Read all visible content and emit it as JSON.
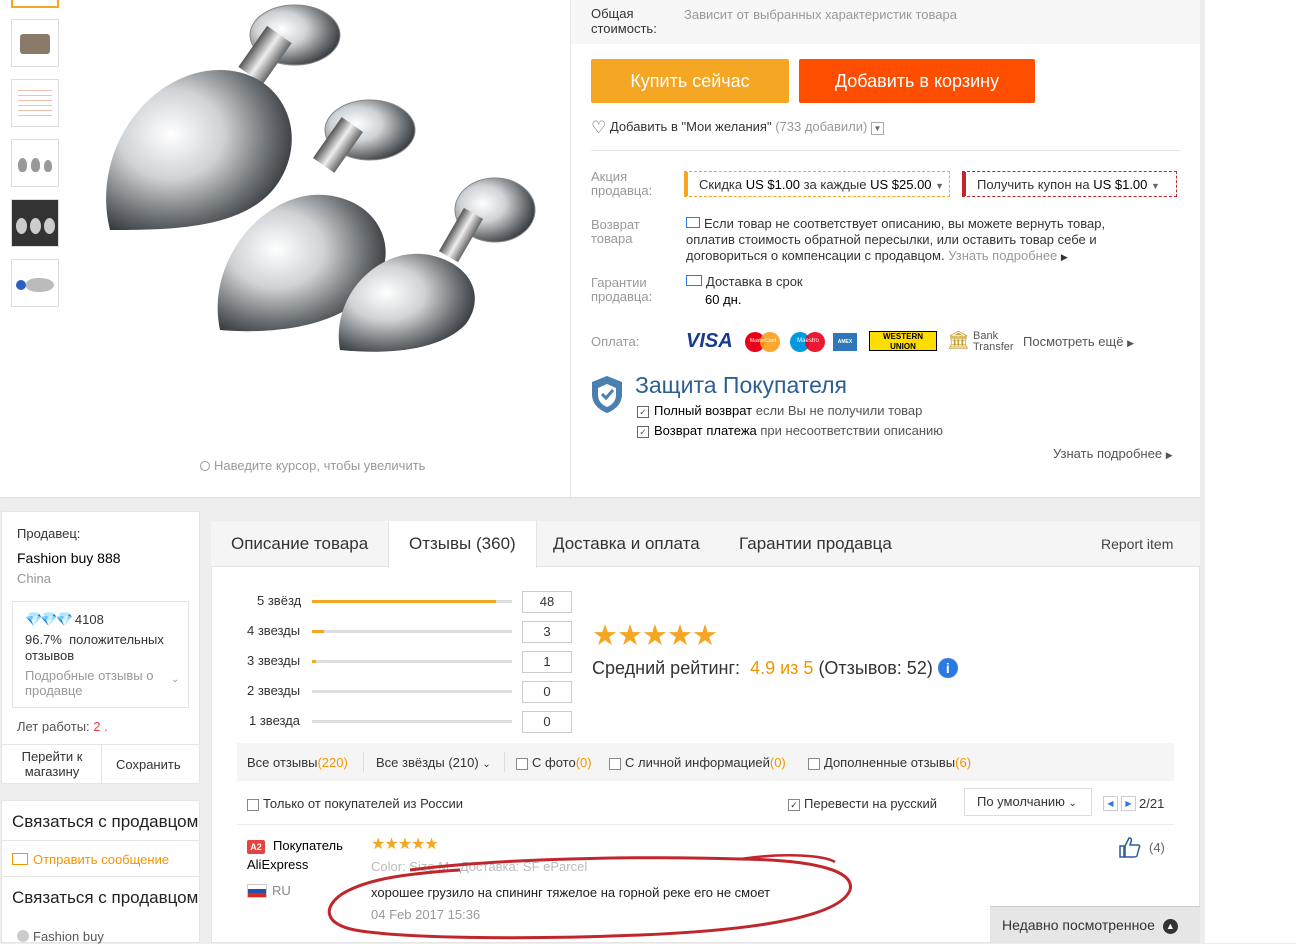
{
  "gallery": {
    "hover_hint": "Наведите курсор, чтобы увеличить"
  },
  "price": {
    "total_label": "Общая стоимость:",
    "total_value": "Зависит от выбранных характеристик товара"
  },
  "actions": {
    "buy_now": "Купить сейчас",
    "add_to_cart": "Добавить в корзину",
    "wishlist_label": "Добавить в \"Мои желания\"",
    "wishlist_count": "(733 добавили)"
  },
  "promo": {
    "label": "Акция продавца:",
    "discount_prefix": "Скидка",
    "discount_amount": "US $1.00",
    "discount_mid": "за каждые",
    "discount_threshold": "US $25.00",
    "coupon_prefix": "Получить купон на",
    "coupon_amount": "US $1.00"
  },
  "returns": {
    "label": "Возврат товара",
    "text": "Если товар не соответствует описанию, вы можете вернуть товар, оплатив стоимость обратной пересылки, или оставить товар себе и договориться о компенсации с продавцом.",
    "link": "Узнать подробнее"
  },
  "guarantee": {
    "label": "Гарантии продавца:",
    "delivery": "Доставка в срок",
    "days": "60 дн."
  },
  "payment": {
    "label": "Оплата:",
    "visa": "VISA",
    "mastercard": "MasterCard",
    "maestro": "Maestro",
    "amex": "AMEX",
    "western_union": "WESTERN UNION",
    "bank_transfer": "Bank Transfer",
    "see_more": "Посмотреть ещё"
  },
  "protection": {
    "title": "Защита Покупателя",
    "item1_bold": "Полный возврат",
    "item1_rest": "если Вы не получили товар",
    "item2_bold": "Возврат платежа",
    "item2_rest": "при несоответствии описанию",
    "more": "Узнать подробнее"
  },
  "seller": {
    "label": "Продавец:",
    "name": "Fashion buy 888",
    "country": "China",
    "score": "4108",
    "positive_pct": "96.7%",
    "positive_text": "положительных отзывов",
    "details": "Подробные отзывы о продавце",
    "years_label": "Лет работы:",
    "years_value": "2",
    "go_store": "Перейти к магазину",
    "save": "Сохранить",
    "contact1": "Связаться с продавцом",
    "send_message": "Отправить сообщение",
    "contact2": "Связаться с продавцом",
    "store_short": "Fashion buy"
  },
  "tabs": {
    "description": "Описание товара",
    "reviews": "Отзывы (360)",
    "shipping": "Доставка и оплата",
    "seller_guarantee": "Гарантии продавца",
    "report": "Report item"
  },
  "ratings": {
    "rows": [
      {
        "label": "5 звёзд",
        "count": "48",
        "fraction": 0.92
      },
      {
        "label": "4 звезды",
        "count": "3",
        "fraction": 0.06
      },
      {
        "label": "3 звезды",
        "count": "1",
        "fraction": 0.02
      },
      {
        "label": "2 звезды",
        "count": "0",
        "fraction": 0
      },
      {
        "label": "1 звезда",
        "count": "0",
        "fraction": 0
      }
    ],
    "avg_label": "Средний рейтинг:",
    "avg_value": "4.9 из 5",
    "count_text": "(Отзывов: 52)",
    "stars": 5
  },
  "filters": {
    "all_reviews": "Все отзывы",
    "all_reviews_count": "(220)",
    "all_stars": "Все звёзды (210)",
    "with_photo": "С фото",
    "with_photo_count": "(0)",
    "personal_info": "С личной информацией",
    "personal_info_count": "(0)",
    "extended": "Дополненные отзывы",
    "extended_count": "(6)",
    "russia_only": "Только от покупателей из России",
    "translate": "Перевести на русский",
    "sort": "По умолчанию",
    "page": "2/21"
  },
  "review": {
    "badge": "A2",
    "buyer_label": "Покупатель",
    "buyer_name": "AliExpress",
    "country": "RU",
    "stars": 5,
    "meta": "Color: Size M   Доставка: SF eParcel",
    "text": "хорошее грузило на спининг тяжелое на горной реке его не смоет",
    "date": "04 Feb 2017 15:36",
    "likes": "(4)"
  },
  "recent": {
    "label": "Недавно посмотренное"
  },
  "colors": {
    "buy_now": "#f5a623",
    "add_to_cart": "#ff4e00",
    "star": "#f5a623",
    "annotation": "#c0272d"
  }
}
